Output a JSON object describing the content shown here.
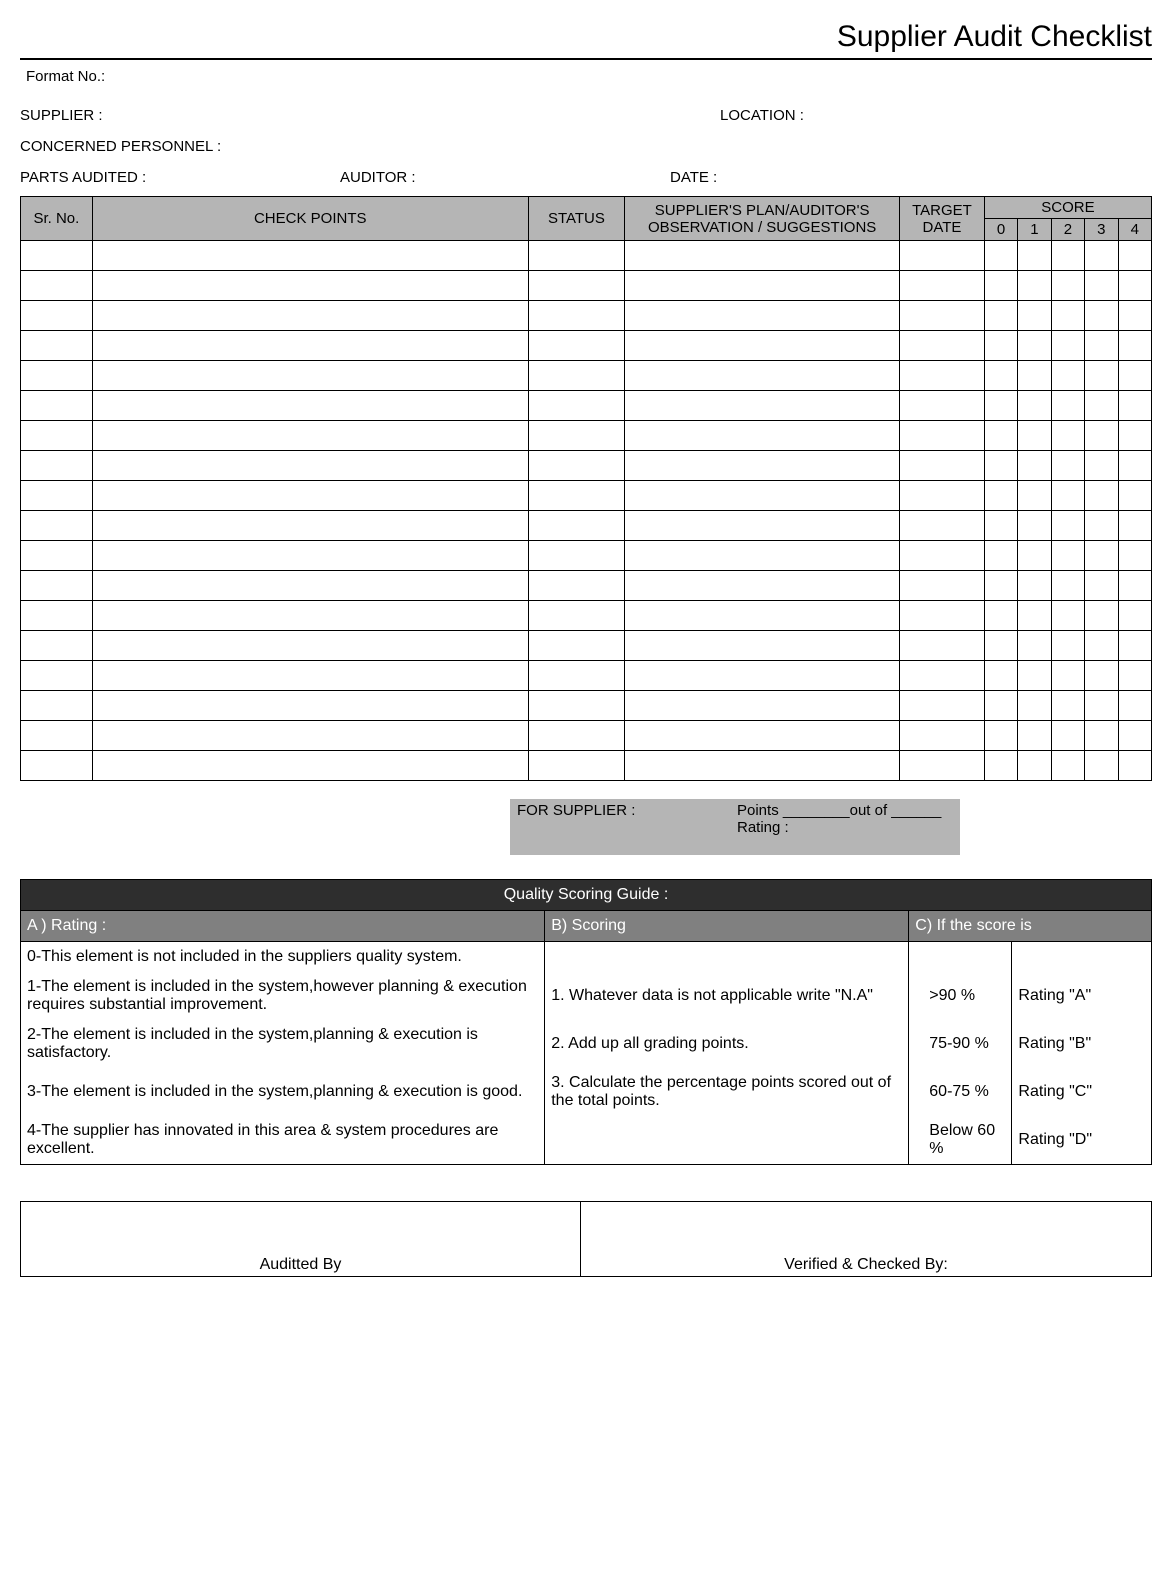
{
  "title": "Supplier Audit Checklist",
  "labels": {
    "format_no": "Format No.:",
    "supplier": "SUPPLIER :",
    "location": "LOCATION :",
    "concerned": "CONCERNED PERSONNEL :",
    "parts_audited": "PARTS AUDITED :",
    "auditor": "AUDITOR :",
    "date": "DATE :"
  },
  "table": {
    "headers": {
      "sr_no": "Sr. No.",
      "check_points": "CHECK POINTS",
      "status": "STATUS",
      "plan": "SUPPLIER'S PLAN/AUDITOR'S OBSERVATION / SUGGESTIONS",
      "target_date": "TARGET DATE",
      "score": "SCORE",
      "s0": "0",
      "s1": "1",
      "s2": "2",
      "s3": "3",
      "s4": "4"
    },
    "row_count": 18
  },
  "supplier_box": {
    "for_supplier": "FOR SUPPLIER :",
    "points_line": "Points ________out of ______",
    "rating_line": "Rating :"
  },
  "guide": {
    "title": "Quality Scoring Guide :",
    "col_a": "A ) Rating :",
    "col_b": "B) Scoring",
    "col_c": "C) If the score is",
    "a0": "0-This element is not included in the suppliers quality system.",
    "a1": "1-The element is included in the system,however planning & execution requires substantial improvement.",
    "a2": "2-The element is included in the system,planning & execution is satisfactory.",
    "a3": "3-The element is included in the system,planning & execution is good.",
    "a4": "4-The supplier has innovated in this area & system procedures are excellent.",
    "b1": "1. Whatever data is not applicable write \"N.A\"",
    "b2": "2. Add up all grading points.",
    "b3": "3. Calculate the percentage points scored out of the total points.",
    "c1p": ">90 %",
    "c1r": "Rating \"A\"",
    "c2p": "75-90 %",
    "c2r": "Rating \"B\"",
    "c3p": "60-75 %",
    "c3r": "Rating \"C\"",
    "c4p": "Below 60 %",
    "c4r": "Rating \"D\""
  },
  "signatures": {
    "audited_by": "Auditted By",
    "verified_by": "Verified & Checked By:"
  }
}
